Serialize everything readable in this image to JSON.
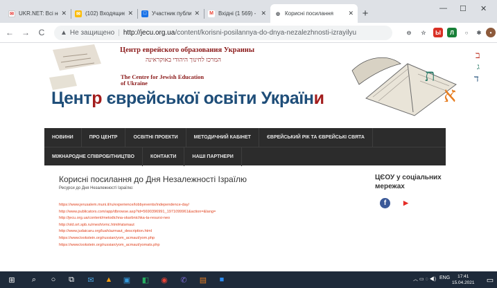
{
  "browser": {
    "tabs": [
      {
        "title": "UKR.NET: Всі новини",
        "favicon": "ukrnet-icon",
        "color": "#ffffff"
      },
      {
        "title": "(102) Входящие",
        "favicon": "mail-icon",
        "color": "#fbbc05"
      },
      {
        "title": "Участник публикац",
        "favicon": "participant-icon",
        "color": "#1a73e8"
      },
      {
        "title": "Вхідні (1 569) - natu",
        "favicon": "gmail-icon",
        "color": "#ea4335"
      },
      {
        "title": "Корисні посилання",
        "favicon": "globe-icon",
        "color": "#5f6368"
      }
    ],
    "new_tab": "+",
    "window_controls": [
      "—",
      "☐",
      "✕"
    ],
    "nav": {
      "back": "←",
      "forward": "→",
      "reload": "C",
      "home": "⌂"
    },
    "security_label": "Не защищено",
    "url_host": "http://jecu.org.ua",
    "url_path": "/content/korisni-posilannya-do-dnya-nezalezhnosti-izrayilyu"
  },
  "site": {
    "header_ru": "Центр еврейского образования Украины",
    "header_he": "המרכז לחינוך היהודי באוקראינה",
    "header_en_1": "The Centre for Jewish Education",
    "header_en_2": "of Ukraine",
    "header_ua_1": "Цент",
    "header_ua_2": "р",
    "header_ua_3": " єврейської освіти ",
    "header_ua_4": "Україн",
    "header_ua_5": "и",
    "menu_row1": [
      "НОВИНИ",
      "ПРО ЦЕНТР",
      "ОСВІТНІ ПРОЕКТИ",
      "МЕТОДИЧНИЙ КАБІНЕТ",
      "ЄВРЕЙСЬКИЙ РІК ТА ЄВРЕЙСЬКІ СВЯТА"
    ],
    "menu_row2": [
      "МІЖНАРОДНЕ СПІВРОБІТНИЦТВО",
      "КОНТАКТИ",
      "НАШІ ПАРТНЕРИ"
    ]
  },
  "content": {
    "title": "Корисні посилання до Дня Незалежності Ізраїлю",
    "subtitle": "Ресурси до Дня Незалежності Ізраїлю:",
    "links": [
      "https://www.jerusalem.muni.il/ru/experience/lobbyevents/independence-day/",
      "http://www.publicators.com/app/dbrowse.asp?id=5690396991_1971099961&action=&lang=",
      "http://jecu.org.ua/content/metodichna-skarbnichka-ta-resursi-neo",
      "http://old.ort.spb.ru/mesh/vmc.html#atsmaut",
      "http://www.judaicaru.org/luah/azmaut_description.html",
      "https://www.lookstein.org/russian/yom_acmaut/yom.php",
      "https://www.lookstein.org/russian/yom_acmaut/yomats.php"
    ],
    "sidebar_title": "ЦЄОУ у соціальних мережах",
    "social": [
      {
        "name": "facebook-icon",
        "glyph": "f",
        "color": "#3b5998"
      },
      {
        "name": "youtube-icon",
        "glyph": "▶",
        "color": "#e52d27"
      }
    ]
  },
  "taskbar": {
    "lang": "ENG",
    "time": "17:41",
    "date": "15.04.2021"
  }
}
